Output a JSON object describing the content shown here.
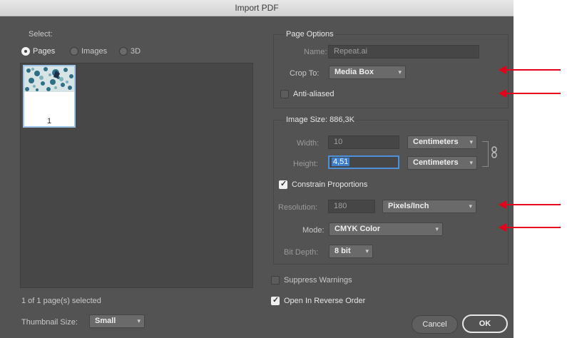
{
  "window": {
    "title": "Import PDF"
  },
  "select": {
    "label": "Select:",
    "options": [
      {
        "label": "Pages",
        "selected": true
      },
      {
        "label": "Images",
        "selected": false
      },
      {
        "label": "3D",
        "selected": false
      }
    ],
    "thumbnail_page_number": "1",
    "status": "1 of 1 page(s) selected",
    "thumbnail_size_label": "Thumbnail Size:",
    "thumbnail_size_value": "Small"
  },
  "page_options": {
    "heading": "Page Options",
    "name_label": "Name:",
    "name_value": "Repeat.ai",
    "crop_label": "Crop To:",
    "crop_value": "Media Box",
    "anti_aliased_label": "Anti-aliased",
    "anti_aliased_checked": false
  },
  "image_size": {
    "heading": "Image Size: 886,3K",
    "width_label": "Width:",
    "width_value": "10",
    "width_unit": "Centimeters",
    "height_label": "Height:",
    "height_value": "4,51",
    "height_unit": "Centimeters",
    "constrain_label": "Constrain Proportions",
    "constrain_checked": true,
    "resolution_label": "Resolution:",
    "resolution_value": "180",
    "resolution_unit": "Pixels/Inch",
    "mode_label": "Mode:",
    "mode_value": "CMYK Color",
    "bit_depth_label": "Bit Depth:",
    "bit_depth_value": "8 bit"
  },
  "options": {
    "suppress_warnings_label": "Suppress Warnings",
    "suppress_warnings_checked": false,
    "reverse_order_label": "Open In Reverse Order",
    "reverse_order_checked": true
  },
  "buttons": {
    "cancel": "Cancel",
    "ok": "OK"
  },
  "icons": {
    "dropdown": "chevron-down-icon",
    "link": "link-icon",
    "annotation": "red-arrow"
  },
  "colors": {
    "dialog_bg": "#535353",
    "focus_blue": "#4d8fd9",
    "annotation_red": "#e3001b"
  }
}
